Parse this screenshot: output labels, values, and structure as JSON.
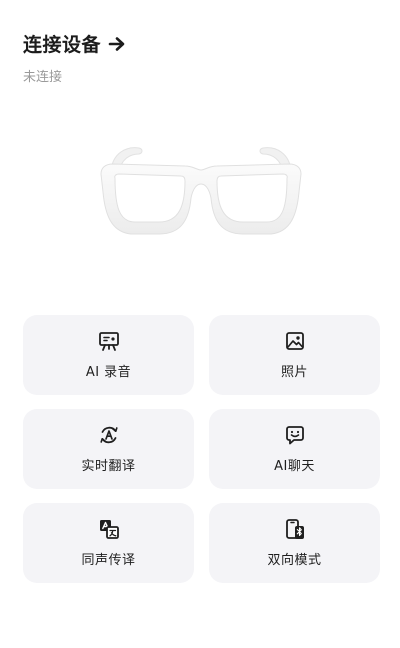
{
  "header": {
    "title": "连接设备",
    "arrow_icon": "arrow-right-icon",
    "status": "未连接"
  },
  "device_image": "glasses-illustration",
  "features": [
    {
      "label": "AI 录音",
      "icon": "recorder-icon"
    },
    {
      "label": "照片",
      "icon": "photo-icon"
    },
    {
      "label": "实时翻译",
      "icon": "translate-icon"
    },
    {
      "label": "AI聊天",
      "icon": "chat-icon"
    },
    {
      "label": "同声传译",
      "icon": "interpret-icon"
    },
    {
      "label": "双向模式",
      "icon": "phone-bluetooth-icon"
    }
  ],
  "colors": {
    "card_bg": "#f4f4f7",
    "text": "#1f1f1f",
    "muted": "#9a9a9a"
  }
}
